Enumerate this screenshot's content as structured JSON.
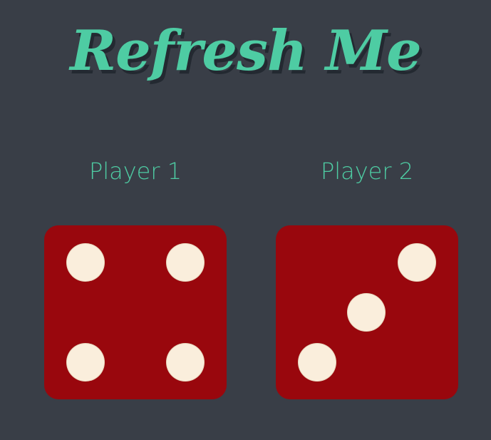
{
  "title": "Refresh Me",
  "players": [
    {
      "label": "Player 1",
      "die_value": 4
    },
    {
      "label": "Player 2",
      "die_value": 3
    }
  ],
  "colors": {
    "background": "#393E47",
    "accent": "#4ECCA3",
    "die_face": "#99070D",
    "pip": "#FAEEDC"
  }
}
